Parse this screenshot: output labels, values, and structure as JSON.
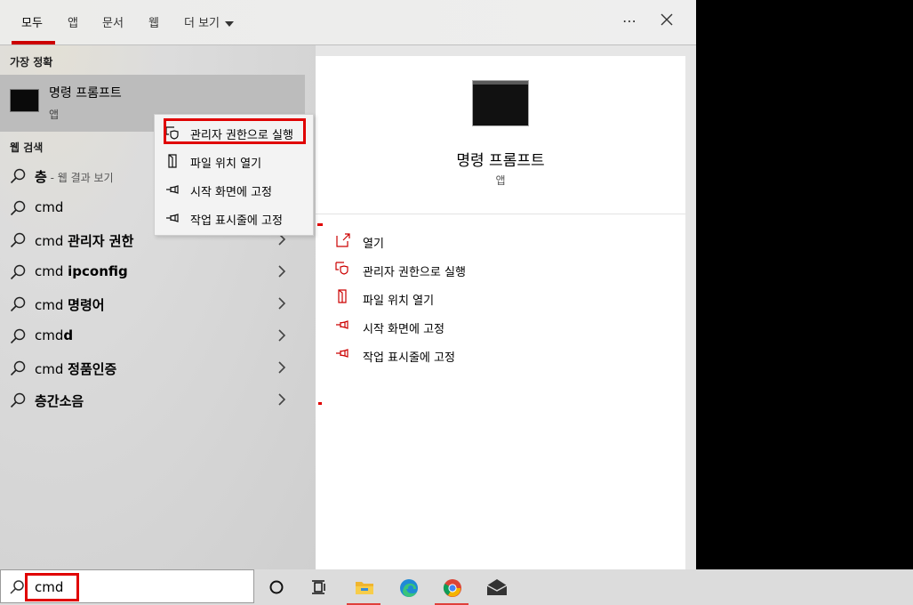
{
  "tabs": [
    {
      "label": "모두",
      "active": true
    },
    {
      "label": "앱"
    },
    {
      "label": "문서"
    },
    {
      "label": "웹"
    },
    {
      "label": "더 보기"
    }
  ],
  "header_icons": [
    "ellipsis-icon",
    "close-icon"
  ],
  "best_match": {
    "section_label": "가장 정확",
    "title": "명령 프롬프트",
    "subtitle": "앱"
  },
  "web_search": {
    "section_label": "웹 검색",
    "items": [
      {
        "prefix": "",
        "bold": "층",
        "hint": " - 웹 결과 보기",
        "chevron": false
      },
      {
        "prefix": "cmd",
        "bold": "",
        "hint": "",
        "chevron": false
      },
      {
        "prefix": "cmd ",
        "bold": "관리자 권한",
        "hint": "",
        "chevron": true
      },
      {
        "prefix": "cmd ",
        "bold": "ipconfig",
        "hint": "",
        "chevron": true
      },
      {
        "prefix": "cmd ",
        "bold": "명령어",
        "hint": "",
        "chevron": true
      },
      {
        "prefix": "cmd",
        "bold": "d",
        "hint": "",
        "chevron": true
      },
      {
        "prefix": "cmd ",
        "bold": "정품인증",
        "hint": "",
        "chevron": true
      },
      {
        "prefix": "",
        "bold": "층간소음",
        "hint": "",
        "chevron": true
      }
    ]
  },
  "context_menu": {
    "items": [
      {
        "label": "관리자 권한으로 실행",
        "icon": "shield-run-icon"
      },
      {
        "label": "파일 위치 열기",
        "icon": "folder-location-icon"
      },
      {
        "label": "시작 화면에 고정",
        "icon": "pin-icon"
      },
      {
        "label": "작업 표시줄에 고정",
        "icon": "pin-icon"
      }
    ]
  },
  "detail": {
    "title": "명령 프롬프트",
    "subtitle": "앱",
    "actions": [
      {
        "label": "열기",
        "icon": "open-icon"
      },
      {
        "label": "관리자 권한으로 실행",
        "icon": "shield-run-icon"
      },
      {
        "label": "파일 위치 열기",
        "icon": "folder-location-icon"
      },
      {
        "label": "시작 화면에 고정",
        "icon": "pin-icon"
      },
      {
        "label": "작업 표시줄에 고정",
        "icon": "pin-icon"
      }
    ]
  },
  "search": {
    "value": "cmd"
  },
  "taskbar": {
    "icons": [
      "cortana-icon",
      "task-view-icon",
      "file-explorer-icon",
      "edge-icon",
      "chrome-icon",
      "mail-icon"
    ]
  },
  "colors": {
    "accent": "#cc0000",
    "highlight": "#e00000",
    "selected_row": "#bcbcbc"
  }
}
